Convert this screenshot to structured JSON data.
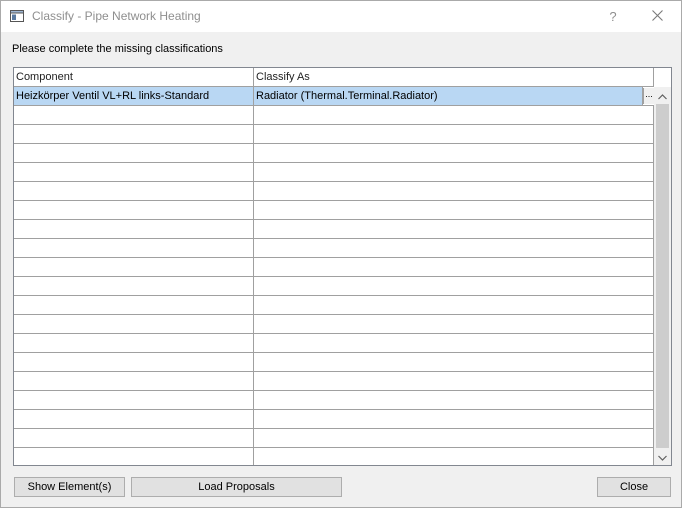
{
  "window": {
    "title": "Classify - Pipe Network Heating",
    "help_glyph": "?",
    "close_glyph": "✕"
  },
  "instruction": "Please complete the missing classifications",
  "table": {
    "columns": [
      "Component",
      "Classify As"
    ],
    "rows": [
      {
        "component": "Heizkörper Ventil VL+RL links-Standard",
        "classify_as": "Radiator (Thermal.Terminal.Radiator)",
        "selected": true
      }
    ],
    "edit_button_label": "..."
  },
  "buttons": {
    "show_elements": "Show Element(s)",
    "load_proposals": "Load Proposals",
    "close": "Close"
  },
  "colors": {
    "selection": "#b9d7f3",
    "button_face": "#e1e1e1",
    "dialog_bg": "#f0f0f0"
  }
}
